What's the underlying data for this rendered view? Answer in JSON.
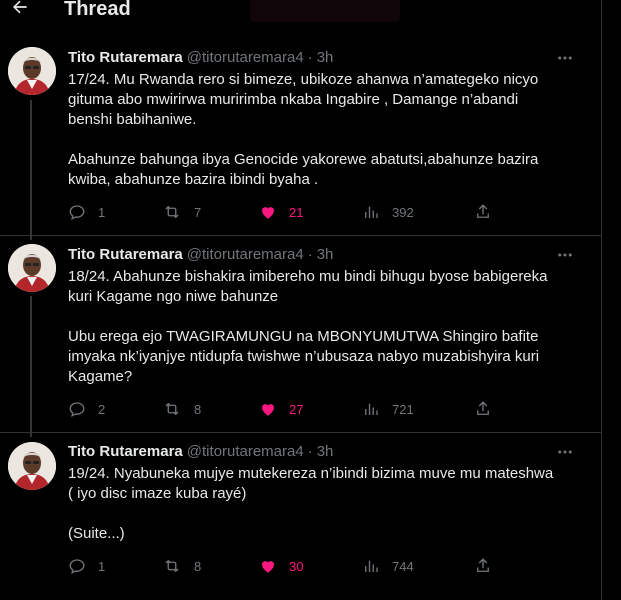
{
  "header": {
    "title": "Thread"
  },
  "tweets": [
    {
      "name": "Tito Rutaremara",
      "handle": "@titorutaremara4",
      "separator": "·",
      "time": "3h",
      "text": "17/24. Mu Rwanda rero si bimeze, ubikoze ahanwa n’amategeko nicyo\ngituma abo mwirirwa muririmba nkaba Ingabire , Damange n’abandi\nbenshi babihaniwe.\n\nAbahunze bahunga ibya Genocide yakorewe abatutsi,abahunze bazira\nkwiba, abahunze bazira ibindi byaha .",
      "replies": "1",
      "retweets": "7",
      "likes": "21",
      "views": "392"
    },
    {
      "name": "Tito Rutaremara",
      "handle": "@titorutaremara4",
      "separator": "·",
      "time": "3h",
      "text": "18/24. Abahunze bishakira imibereho mu bindi bihugu byose babigereka\nkuri Kagame ngo niwe bahunze\n\nUbu erega ejo TWAGIRAMUNGU na MBONYUMUTWA Shingiro bafite\nimyaka nk’iyanjye ntidupfa twishwe n’ubusaza nabyo muzabishyira kuri\nKagame?",
      "replies": "2",
      "retweets": "8",
      "likes": "27",
      "views": "721"
    },
    {
      "name": "Tito Rutaremara",
      "handle": "@titorutaremara4",
      "separator": "·",
      "time": "3h",
      "text": "19/24. Nyabuneka mujye mutekereza n’ibindi bizima muve mu mateshwa\n( iyo disc imaze kuba rayé)\n\n(Suite...)",
      "replies": "1",
      "retweets": "8",
      "likes": "30",
      "views": "744"
    }
  ],
  "colors": {
    "background": "#000000",
    "text": "#e7e9ea",
    "muted": "#71767b",
    "like": "#f91880",
    "border": "#2f3336"
  },
  "icons": [
    "back-arrow-icon",
    "more-icon",
    "reply-icon",
    "retweet-icon",
    "heart-icon",
    "views-icon",
    "share-icon"
  ]
}
